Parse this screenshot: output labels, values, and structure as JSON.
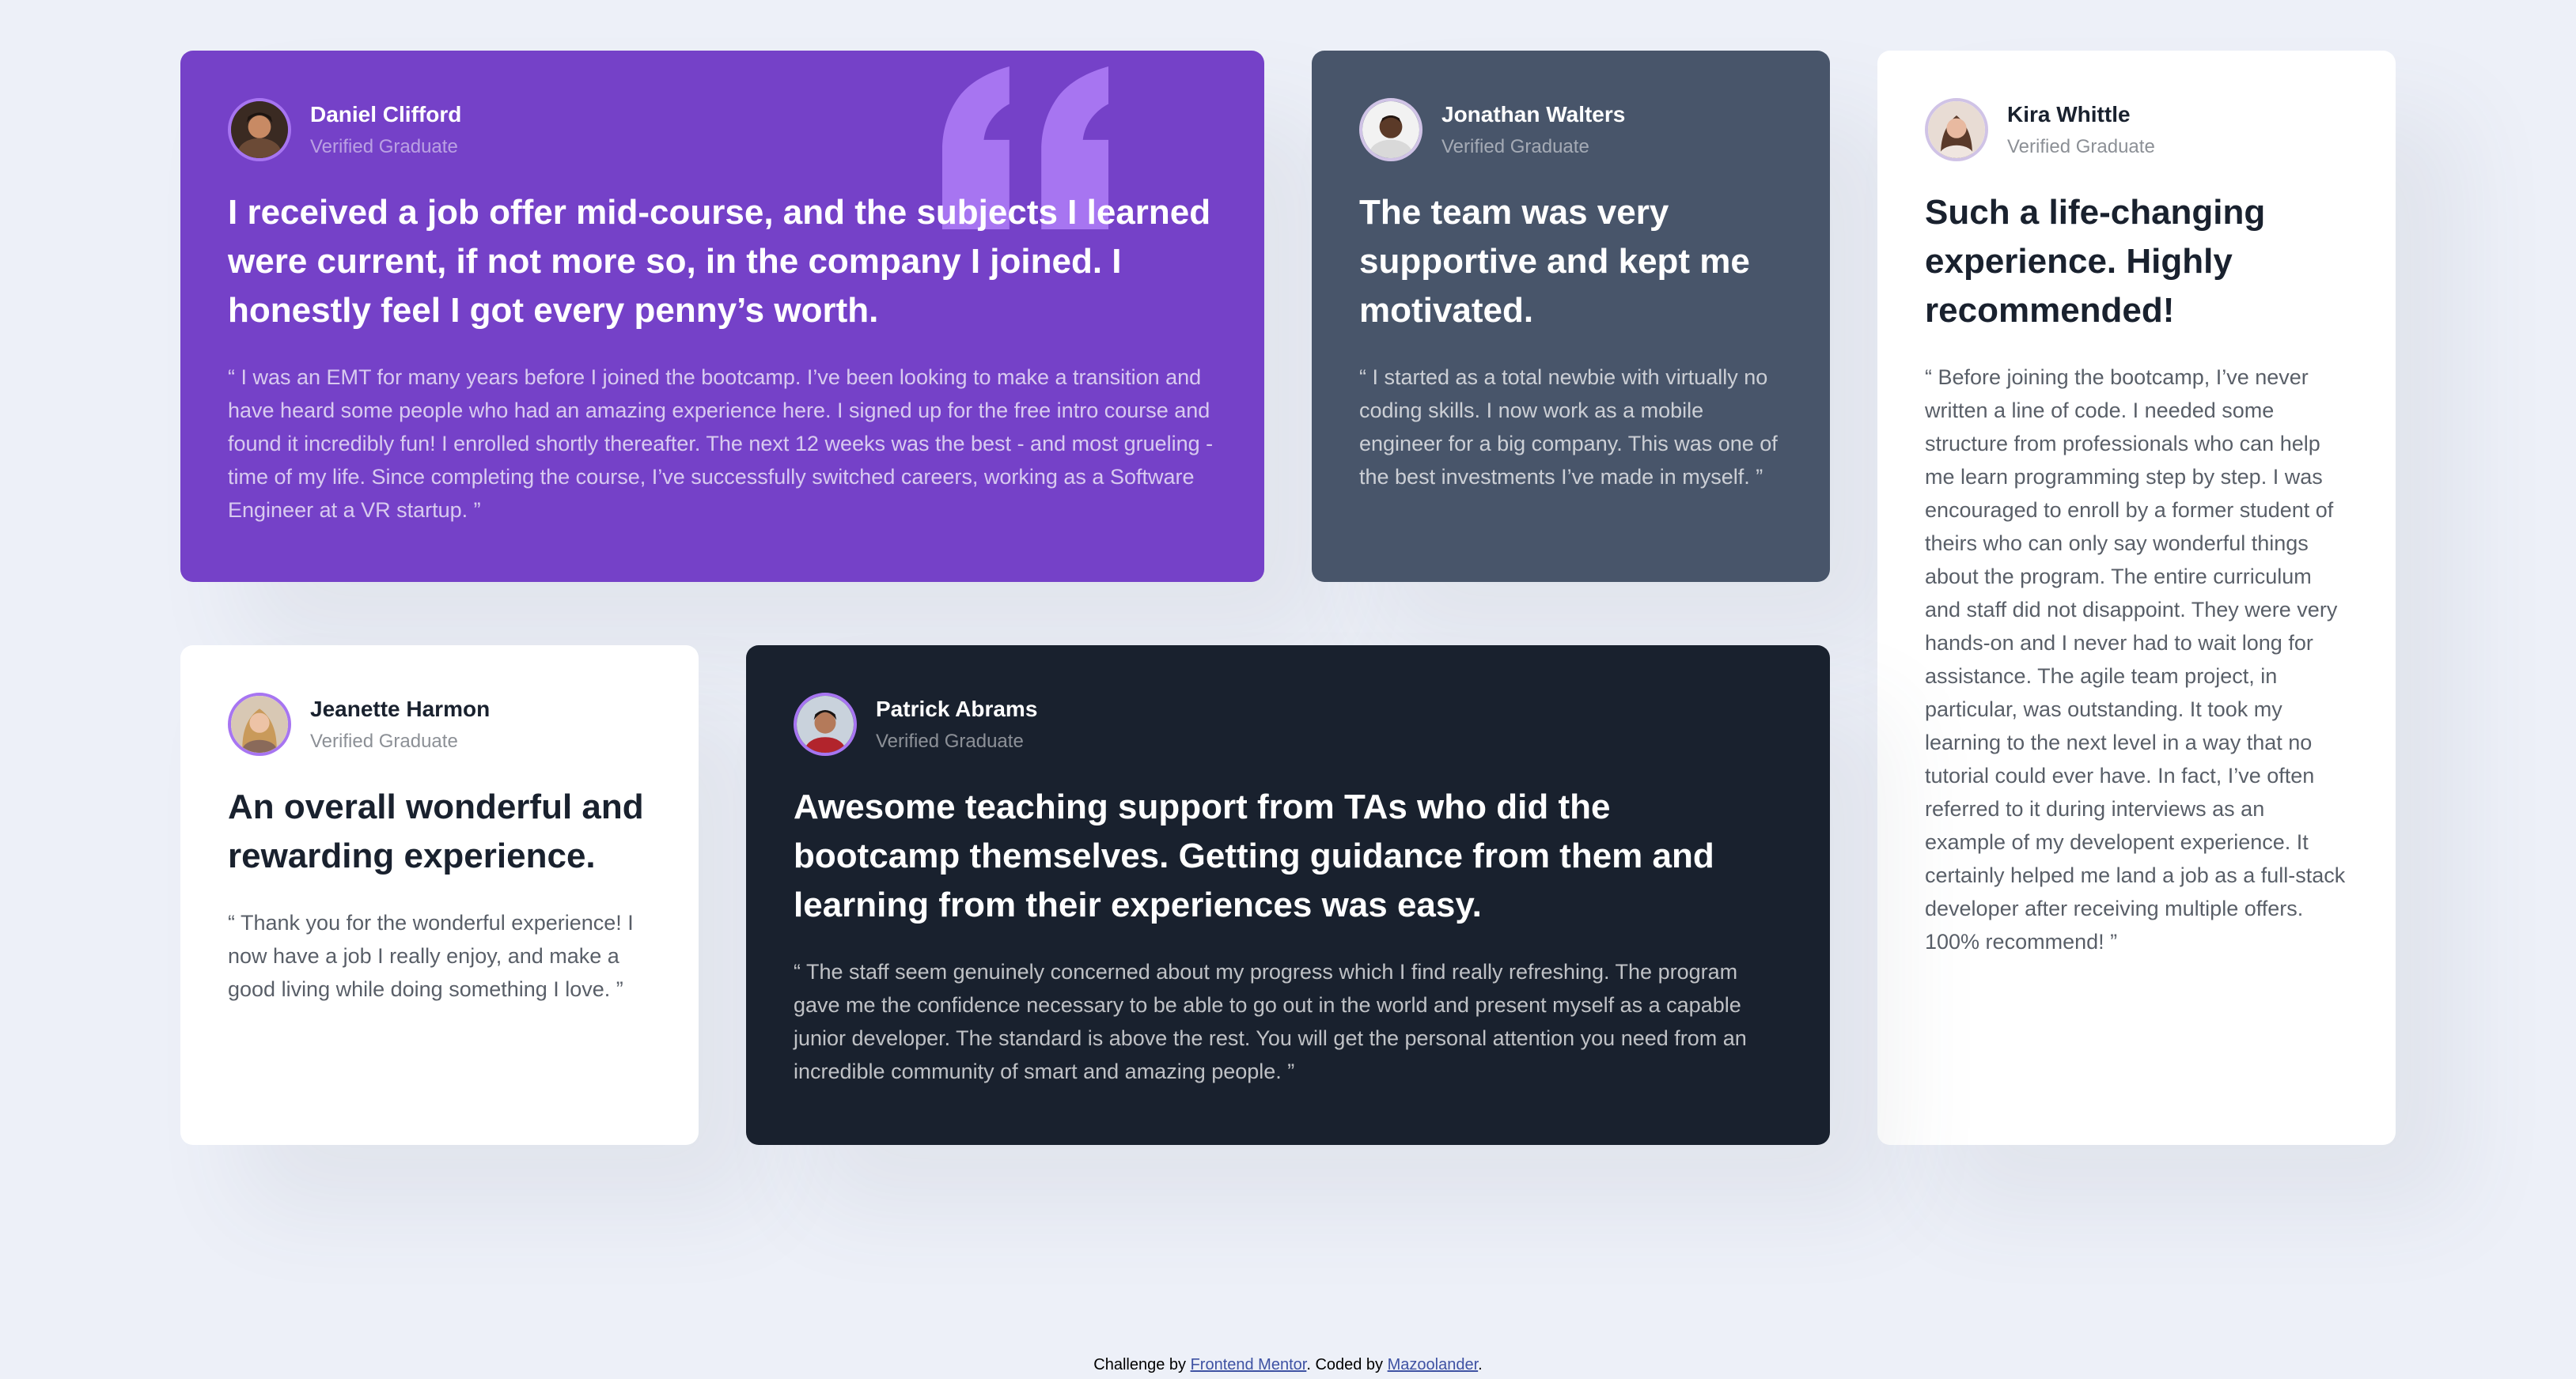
{
  "testimonials": [
    {
      "name": "Daniel Clifford",
      "role": "Verified Graduate",
      "headline": "I received a job offer mid-course, and the subjects I learned were current, if not more so, in the company I joined. I honestly feel I got every penny’s worth.",
      "body": "“ I was an EMT for many years before I joined the bootcamp. I’ve been looking to make a transition and have heard some people who had an amazing experience here. I signed up for the free intro course and found it incredibly fun! I enrolled shortly thereafter. The next 12 weeks was the best - and most grueling - time of my life. Since completing the course, I’ve successfully switched careers, working as a Software Engineer at a VR startup. ”",
      "theme": "purple",
      "color": "#7541c8"
    },
    {
      "name": "Jonathan Walters",
      "role": "Verified Graduate",
      "headline": "The team was very supportive and kept me motivated.",
      "body": "“ I started as a total newbie with virtually no coding skills. I now work as a mobile engineer for a big company. This was one of the best investments I’ve made in myself. ”",
      "theme": "gray",
      "color": "#48556a"
    },
    {
      "name": "Kira Whittle",
      "role": "Verified Graduate",
      "headline": "Such a life-changing experience. Highly recommended!",
      "body": "“ Before joining the bootcamp, I’ve never written a line of code. I needed some structure from professionals who can help me learn programming step by step. I was encouraged to enroll by a former student of theirs who can only say wonderful things about the program. The entire curriculum and staff did not disappoint. They were very hands-on and I never had to wait long for assistance. The agile team project, in particular, was outstanding. It took my learning to the next level in a way that no tutorial could ever have. In fact, I’ve often referred to it during interviews as an example of my developent experience. It certainly helped me land a job as a full-stack developer after receiving multiple offers. 100% recommend! ”",
      "theme": "white",
      "color": "#ffffff"
    },
    {
      "name": "Jeanette Harmon",
      "role": "Verified Graduate",
      "headline": "An overall wonderful and rewarding experience.",
      "body": "“ Thank you for the wonderful experience! I now have a job I really enjoy, and make a good living while doing something I love. ”",
      "theme": "white",
      "color": "#ffffff"
    },
    {
      "name": "Patrick Abrams",
      "role": "Verified Graduate",
      "headline": "Awesome teaching support from TAs who did the bootcamp themselves. Getting guidance from them and learning from their experiences was easy.",
      "body": "“ The staff seem genuinely concerned about my progress which I find really refreshing. The program gave me the confidence necessary to be able to go out in the world and present myself as a capable junior developer. The standard is above the rest. You will get the personal attention you need from an incredible community of smart and amazing people. ”",
      "theme": "dark",
      "color": "#19212e"
    }
  ],
  "footer": {
    "prefix": "Challenge by ",
    "challenge_link": "Frontend Mentor",
    "middle": ". Coded by ",
    "author_link": "Mazoolander",
    "suffix": "."
  },
  "colors": {
    "page_background": "#edf0f8",
    "quote_icon": "#a775f1",
    "link": "#3e52a3"
  },
  "icons": {
    "quote": "quotation-mark-icon"
  }
}
